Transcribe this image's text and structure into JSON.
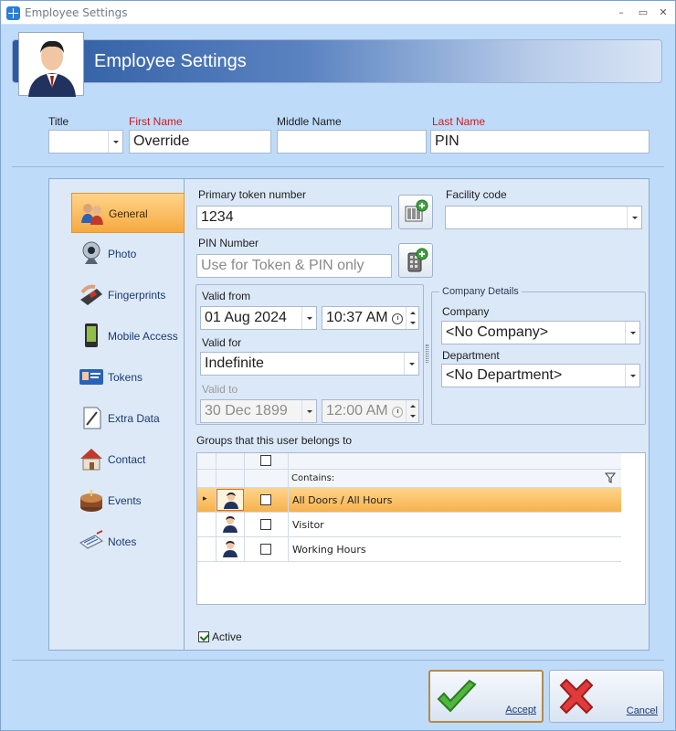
{
  "window": {
    "title": "Employee Settings"
  },
  "header": {
    "title": "Employee Settings"
  },
  "names": {
    "title_label": "Title",
    "title_value": "",
    "first_label": "First Name",
    "first_value": "Override",
    "middle_label": "Middle Name",
    "middle_value": "",
    "last_label": "Last Name",
    "last_value": "PIN"
  },
  "nav": {
    "items": [
      {
        "label": "General",
        "icon": "users-icon",
        "active": true
      },
      {
        "label": "Photo",
        "icon": "webcam-icon"
      },
      {
        "label": "Fingerprints",
        "icon": "fingerprint-icon"
      },
      {
        "label": "Mobile Access",
        "icon": "phone-icon"
      },
      {
        "label": "Tokens",
        "icon": "id-card-icon"
      },
      {
        "label": "Extra Data",
        "icon": "note-icon"
      },
      {
        "label": "Contact",
        "icon": "house-icon"
      },
      {
        "label": "Events",
        "icon": "cake-icon"
      },
      {
        "label": "Notes",
        "icon": "notebook-icon"
      }
    ]
  },
  "general": {
    "primary_token_label": "Primary token number",
    "primary_token_value": "1234",
    "facility_code_label": "Facility code",
    "facility_code_value": "",
    "pin_label": "PIN Number",
    "pin_placeholder": "Use for Token & PIN only",
    "valid_from_label": "Valid from",
    "valid_from_date": "01 Aug 2024",
    "valid_from_time": "10:37 AM",
    "valid_for_label": "Valid for",
    "valid_for_value": "Indefinite",
    "valid_to_label": "Valid to",
    "valid_to_date": "30 Dec 1899",
    "valid_to_time": "12:00 AM",
    "company_group_label": "Company Details",
    "company_label": "Company",
    "company_value": "<No Company>",
    "department_label": "Department",
    "department_value": "<No Department>",
    "groups_label": "Groups that this user belongs to",
    "groups_filter_header": "Contains:",
    "groups": [
      {
        "name": "All Doors / All Hours",
        "selected": true,
        "checked": false
      },
      {
        "name": "Visitor",
        "selected": false,
        "checked": false
      },
      {
        "name": "Working Hours",
        "selected": false,
        "checked": false
      }
    ],
    "active_label": "Active",
    "active_checked": true
  },
  "actions": {
    "accept_label": "Accept",
    "cancel_label": "Cancel"
  },
  "colors": {
    "accent": "#f6a940",
    "window_bg": "#bfdbfa",
    "header_blue": "#2c5aa0",
    "required_red": "#d01a1a"
  }
}
